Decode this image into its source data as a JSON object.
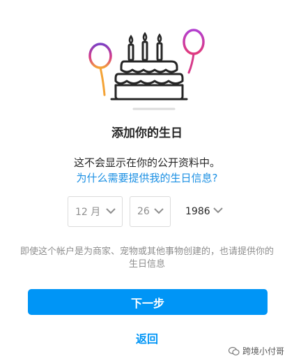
{
  "header": {
    "title": "添加你的生日"
  },
  "body": {
    "description": "这不会显示在你的公开资料中。",
    "why_link": "为什么需要提供我的生日信息?"
  },
  "birthday": {
    "month": "12 月",
    "day": "26",
    "year": "1986"
  },
  "note": "即使这个帐户是为商家、宠物或其他事物创建的，也请提供你的生日信息",
  "actions": {
    "next_label": "下一步",
    "back_label": "返回"
  },
  "watermark": {
    "text": "跨境小付哥"
  },
  "colors": {
    "primary": "#0095f6",
    "link": "#1a8fe3",
    "text": "#262626",
    "muted": "#8e8e8e",
    "border": "#dbdbdb"
  },
  "icons": {
    "illustration": "birthday-cake-balloons-illustration",
    "chevron": "chevron-down-icon",
    "watermark": "wechat-icon"
  }
}
